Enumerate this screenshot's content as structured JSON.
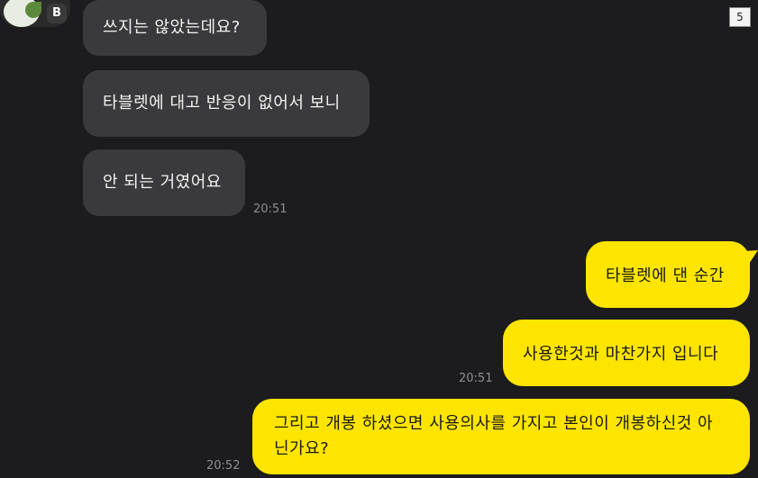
{
  "page_number": "5",
  "avatar_badge": "B",
  "messages": {
    "received": [
      {
        "text": "쓰지는 않았는데요?"
      },
      {
        "text": "타블렛에 대고 반응이 없어서 보니"
      },
      {
        "text": "안 되는 거였어요"
      }
    ],
    "received_time": "20:51",
    "sent": [
      {
        "text": "타블렛에 댄 순간"
      },
      {
        "text": "사용한것과 마찬가지 입니다"
      }
    ],
    "sent_time": "20:51",
    "sent2": {
      "text": "그리고 개봉 하셨으면 사용의사를 가지고 본인이 개봉하신것 아닌가요?"
    },
    "sent2_time": "20:52"
  },
  "colors": {
    "background": "#1c1c1e",
    "received_bubble": "#3a3a3c",
    "sent_bubble": "#fee500"
  }
}
